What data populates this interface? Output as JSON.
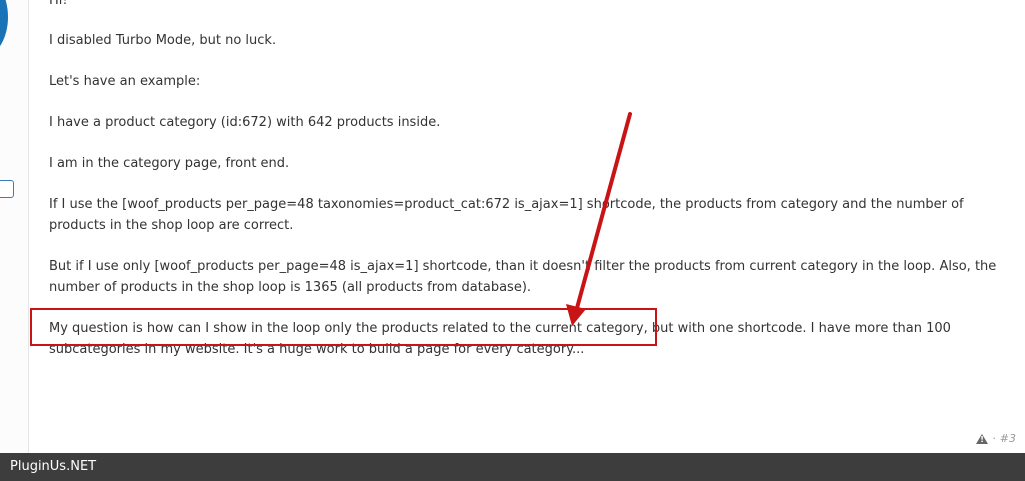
{
  "post": {
    "greeting": "Hi!",
    "p1": "I disabled Turbo Mode, but no luck.",
    "p2": "Let's have an example:",
    "p3": "I have a product category (id:672) with 642 products inside.",
    "p4": "I am in the category page, front end.",
    "p5": "If I use the [woof_products per_page=48 taxonomies=product_cat:672 is_ajax=1] shortcode, the products from category and the number of products in the shop loop are correct.",
    "p6": "But if I use only [woof_products per_page=48 is_ajax=1] shortcode, than it doesn't filter the products from current category in the loop. Also, the number of products in the shop loop is 1365 (all products from database).",
    "p7": "My question is how can I show in the loop only the products related to the current category, but with one shortcode. I have more than 100 subcategories in my website. It's a huge work to build a page for every category..."
  },
  "meta": {
    "separator": "·",
    "post_number": "#3"
  },
  "footer": {
    "brand": "PluginUs.NET"
  },
  "colors": {
    "annotation": "#c81414",
    "footer_bg": "#3d3d3d",
    "avatar": "#1a73b7"
  }
}
